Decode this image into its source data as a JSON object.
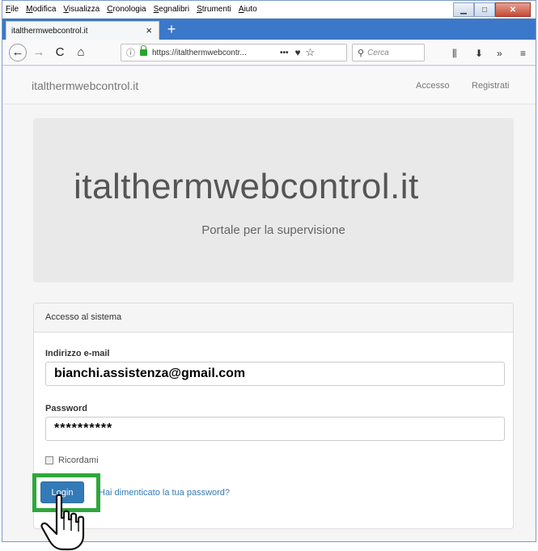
{
  "menubar": {
    "items": [
      "File",
      "Modifica",
      "Visualizza",
      "Cronologia",
      "Segnalibri",
      "Strumenti",
      "Aiuto"
    ]
  },
  "tab": {
    "title": "italthermwebcontrol.it",
    "close": "×"
  },
  "newtab": "+",
  "urlbar": {
    "url": "https://italthermwebcontr...",
    "dots": "•••"
  },
  "search": {
    "placeholder": "Cerca"
  },
  "site": {
    "brand": "italthermwebcontrol.it",
    "nav": {
      "accesso": "Accesso",
      "registrati": "Registrati"
    }
  },
  "hero": {
    "title": "italthermwebcontrol.it",
    "subtitle": "Portale per la supervisione"
  },
  "login": {
    "heading": "Accesso al sistema",
    "email_label": "Indirizzo e-mail",
    "email_value": "bianchi.assistenza@gmail.com",
    "password_label": "Password",
    "password_value": "**********",
    "remember_label": "Ricordami",
    "login_button": "Login",
    "forgot_link": "Hai dimenticato la tua password?"
  },
  "colors": {
    "primary": "#337ab7",
    "highlight": "#2ea73a",
    "tabstrip": "#3b78c9"
  }
}
